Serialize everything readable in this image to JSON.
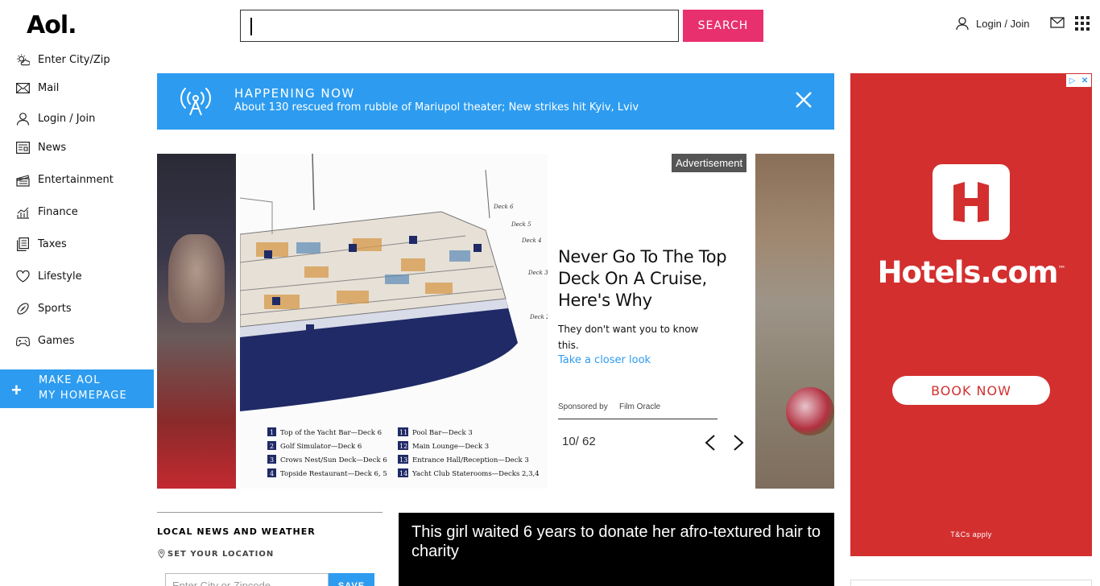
{
  "header": {
    "logo": "Aol.",
    "search_button": "SEARCH",
    "login": "Login / Join"
  },
  "sidebar": {
    "items": [
      {
        "label": "Enter City/Zip",
        "icon": "weather-icon"
      },
      {
        "label": "Mail",
        "icon": "mail-icon"
      },
      {
        "label": "Login / Join",
        "icon": "user-icon"
      },
      {
        "label": "News",
        "icon": "news-icon"
      },
      {
        "label": "Entertainment",
        "icon": "clapper-icon"
      },
      {
        "label": "Finance",
        "icon": "chart-icon"
      },
      {
        "label": "Taxes",
        "icon": "document-icon"
      },
      {
        "label": "Lifestyle",
        "icon": "heart-icon"
      },
      {
        "label": "Sports",
        "icon": "football-icon"
      },
      {
        "label": "Games",
        "icon": "gamepad-icon"
      }
    ],
    "make_homepage": {
      "line1": "MAKE AOL",
      "line2": "MY HOMEPAGE"
    }
  },
  "banner": {
    "title": "HAPPENING NOW",
    "text": "About 130 rescued from rubble of Mariupol theater; New strikes hit Kyiv, Lviv"
  },
  "slideshow": {
    "ad_tag": "Advertisement",
    "headline": "Never Go To The Top Deck On A Cruise, Here's Why",
    "subtext": "They don't want you to know this.",
    "cta": "Take a closer look",
    "sponsored_label": "Sponsored by",
    "sponsor": "Film Oracle",
    "counter": "10/ 62",
    "legend": [
      {
        "num": "1",
        "text": "Top of the Yacht Bar—Deck 6"
      },
      {
        "num": "2",
        "text": "Golf Simulator—Deck 6"
      },
      {
        "num": "3",
        "text": "Crows Nest/Sun Deck—Deck 6"
      },
      {
        "num": "4",
        "text": "Topside Restaurant—Deck 6, 5"
      },
      {
        "num": "11",
        "text": "Pool Bar—Deck 3"
      },
      {
        "num": "12",
        "text": "Main Lounge—Deck 3"
      },
      {
        "num": "13",
        "text": "Entrance Hall/Reception—Deck 3"
      },
      {
        "num": "14",
        "text": "Yacht Club Staterooms—Decks 2,3,4"
      }
    ],
    "deck_labels": [
      "Deck 6",
      "Deck 5",
      "Deck 4",
      "Deck 3",
      "Deck 2"
    ]
  },
  "local_news": {
    "heading": "LOCAL NEWS AND WEATHER",
    "set_location": "SET YOUR LOCATION",
    "zip_placeholder": "Enter City or Zipcode",
    "save": "SAVE"
  },
  "video": {
    "title": "This girl waited 6 years to donate her afro-textured hair to charity"
  },
  "hotels_ad": {
    "brand": "Hotels.com",
    "trademark": "™",
    "button": "BOOK NOW",
    "terms": "T&Cs apply",
    "colors": {
      "background": "#d32f2f",
      "text": "#ffffff"
    }
  },
  "colors": {
    "accent_blue": "#2d9cf0",
    "search_pink": "#e8306f"
  }
}
